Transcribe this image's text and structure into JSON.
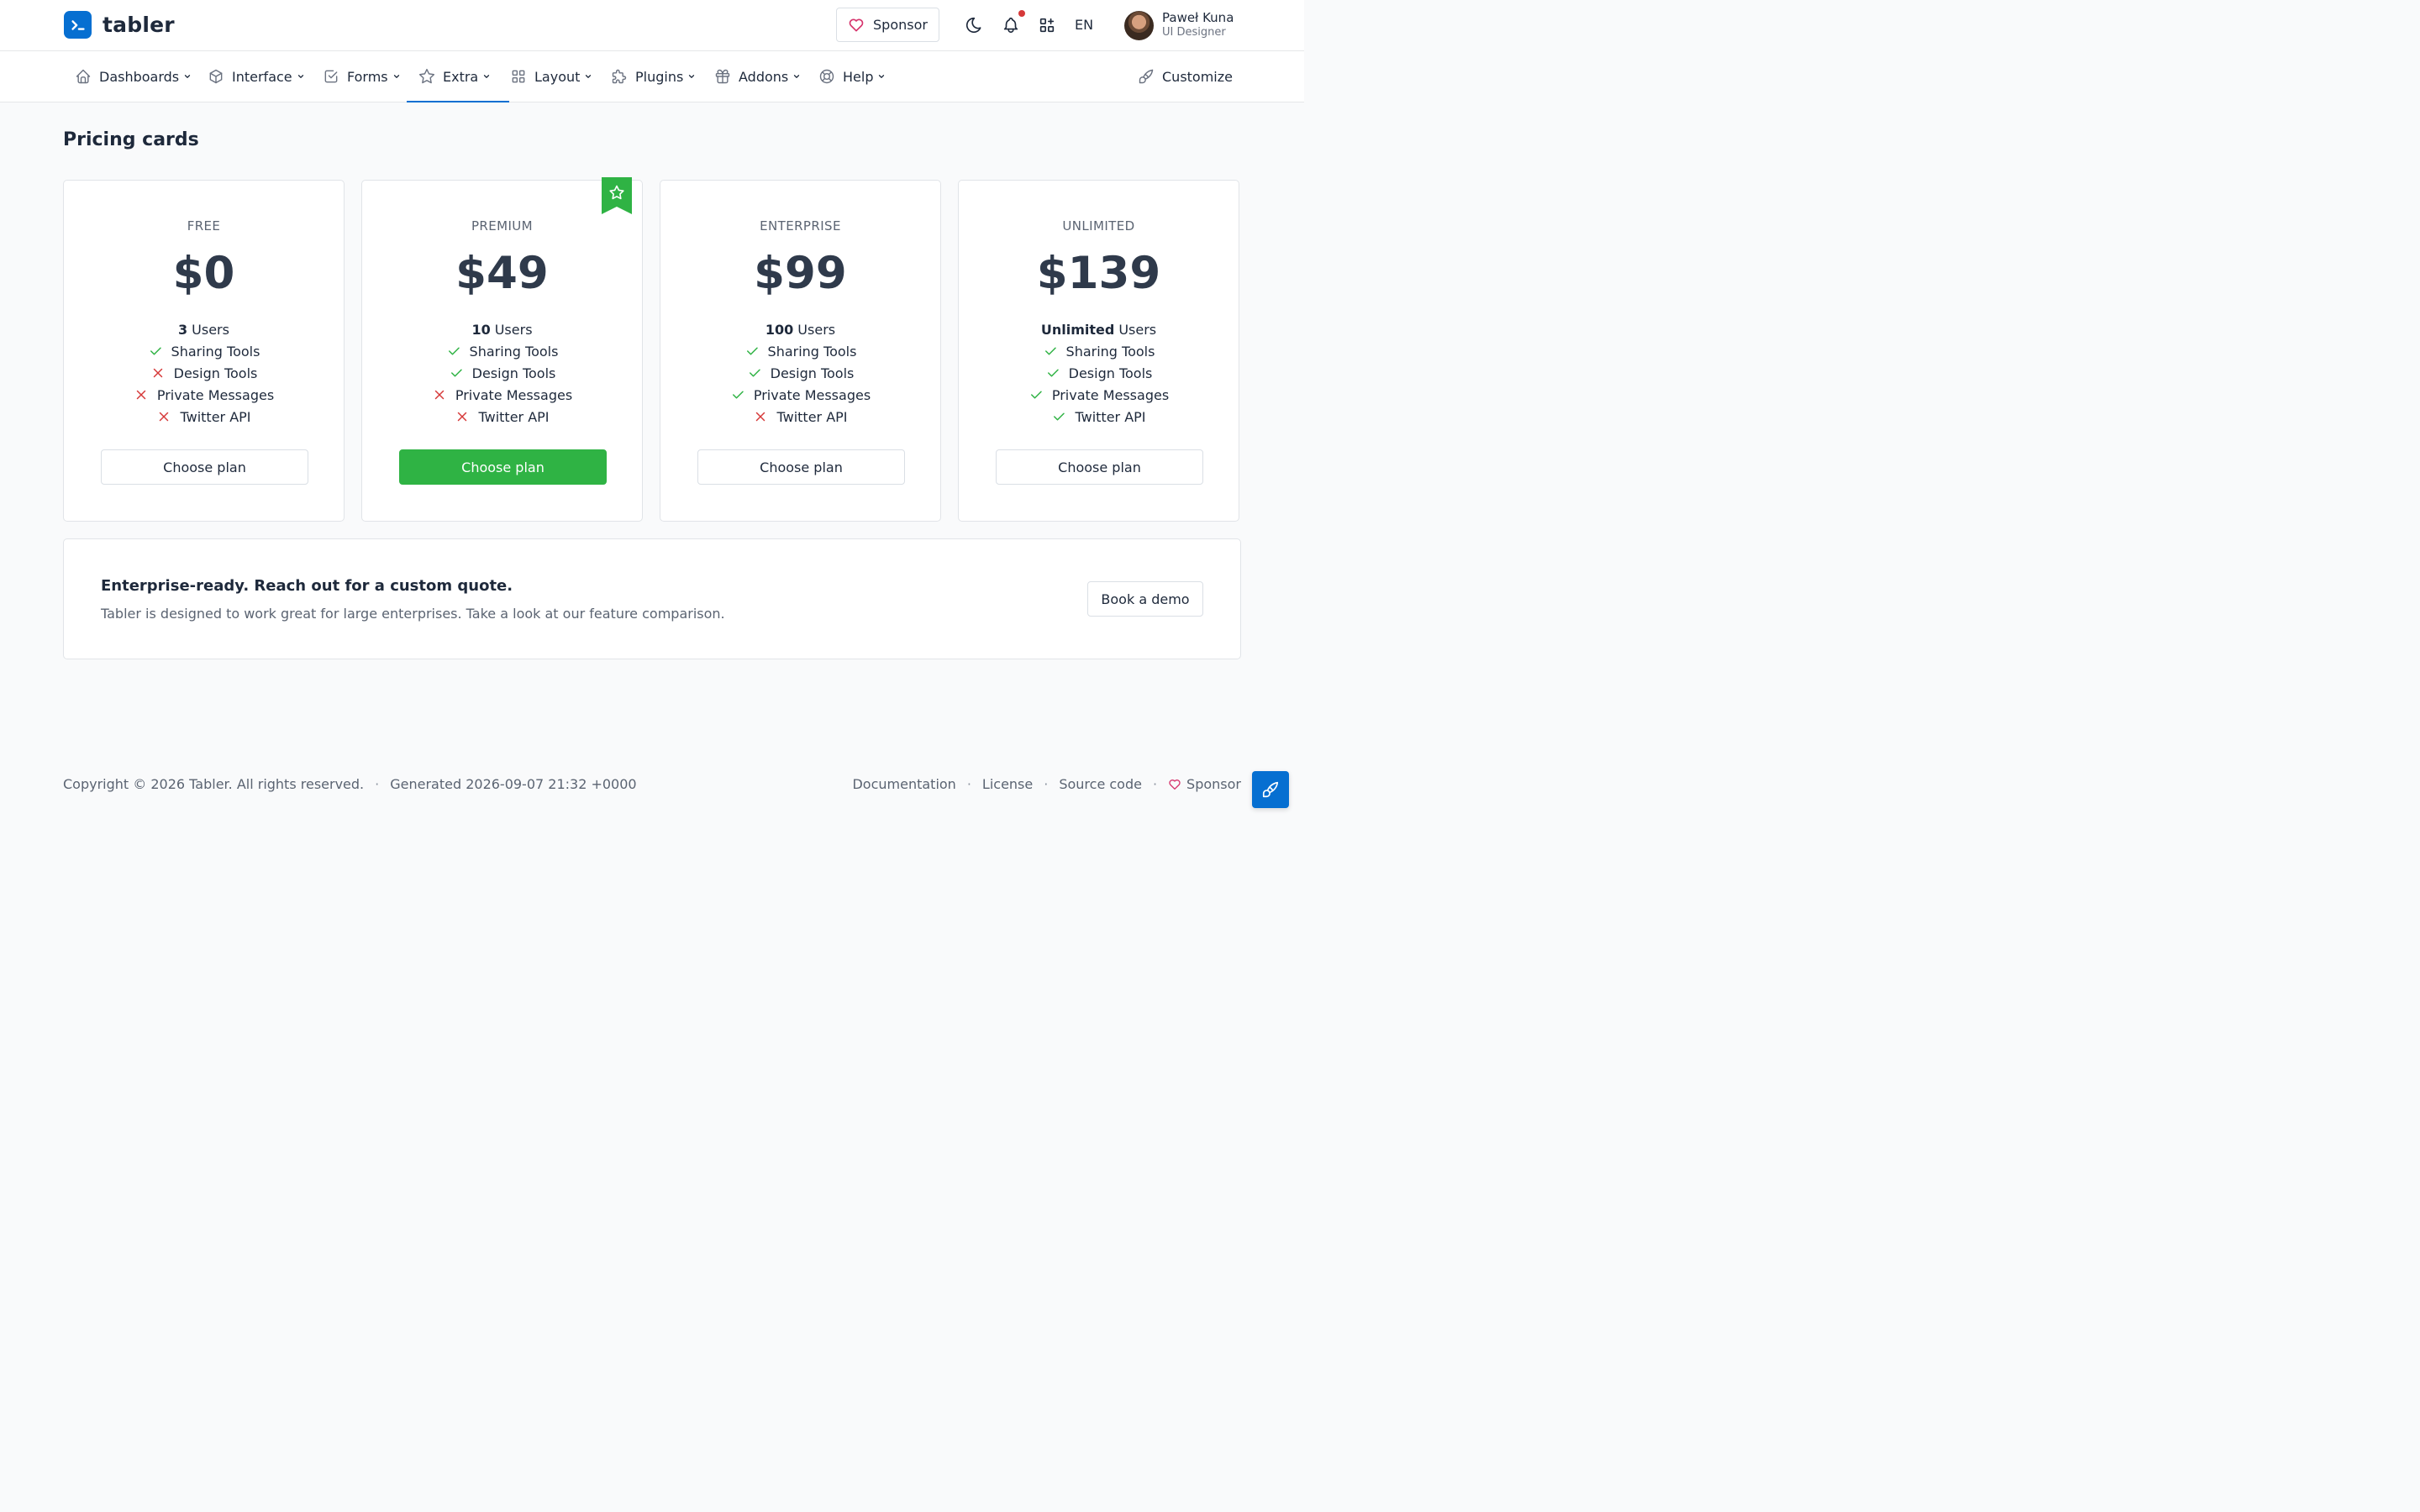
{
  "header": {
    "brand": "tabler",
    "sponsor_label": "Sponsor",
    "language": "EN",
    "user": {
      "name": "Paweł Kuna",
      "role": "UI Designer"
    },
    "icons": [
      "moon-icon",
      "bell-icon",
      "apps-icon"
    ]
  },
  "nav": {
    "items": [
      {
        "label": "Dashboards",
        "icon": "home-icon"
      },
      {
        "label": "Interface",
        "icon": "package-icon"
      },
      {
        "label": "Forms",
        "icon": "checkbox-icon"
      },
      {
        "label": "Extra",
        "icon": "star-icon",
        "active": true
      },
      {
        "label": "Layout",
        "icon": "layout-grid-icon"
      },
      {
        "label": "Plugins",
        "icon": "puzzle-icon"
      },
      {
        "label": "Addons",
        "icon": "gift-icon"
      },
      {
        "label": "Help",
        "icon": "lifebuoy-icon"
      }
    ],
    "customize": "Customize"
  },
  "page": {
    "title": "Pricing cards"
  },
  "plans": [
    {
      "name": "FREE",
      "price": "$0",
      "users_count": "3",
      "users_label": "Users",
      "features": [
        {
          "label": "Sharing Tools",
          "included": true
        },
        {
          "label": "Design Tools",
          "included": false
        },
        {
          "label": "Private Messages",
          "included": false
        },
        {
          "label": "Twitter API",
          "included": false
        }
      ],
      "button": "Choose plan"
    },
    {
      "name": "PREMIUM",
      "price": "$49",
      "users_count": "10",
      "users_label": "Users",
      "featured": true,
      "features": [
        {
          "label": "Sharing Tools",
          "included": true
        },
        {
          "label": "Design Tools",
          "included": true
        },
        {
          "label": "Private Messages",
          "included": false
        },
        {
          "label": "Twitter API",
          "included": false
        }
      ],
      "button": "Choose plan"
    },
    {
      "name": "ENTERPRISE",
      "price": "$99",
      "users_count": "100",
      "users_label": "Users",
      "features": [
        {
          "label": "Sharing Tools",
          "included": true
        },
        {
          "label": "Design Tools",
          "included": true
        },
        {
          "label": "Private Messages",
          "included": true
        },
        {
          "label": "Twitter API",
          "included": false
        }
      ],
      "button": "Choose plan"
    },
    {
      "name": "UNLIMITED",
      "price": "$139",
      "users_count": "Unlimited",
      "users_label": "Users",
      "features": [
        {
          "label": "Sharing Tools",
          "included": true
        },
        {
          "label": "Design Tools",
          "included": true
        },
        {
          "label": "Private Messages",
          "included": true
        },
        {
          "label": "Twitter API",
          "included": true
        }
      ],
      "button": "Choose plan"
    }
  ],
  "cta": {
    "title": "Enterprise-ready. Reach out for a custom quote.",
    "text": "Tabler is designed to work great for large enterprises. Take a look at our feature comparison.",
    "button": "Book a demo"
  },
  "footer": {
    "copyright": "Copyright © 2026 Tabler. All rights reserved.",
    "generated": "Generated 2026-09-07 21:32 +0000",
    "links": [
      "Documentation",
      "License",
      "Source code",
      "Sponsor"
    ],
    "separator": "·"
  },
  "colors": {
    "primary": "#066fd1",
    "success": "#2fb344",
    "danger": "#d63939"
  }
}
